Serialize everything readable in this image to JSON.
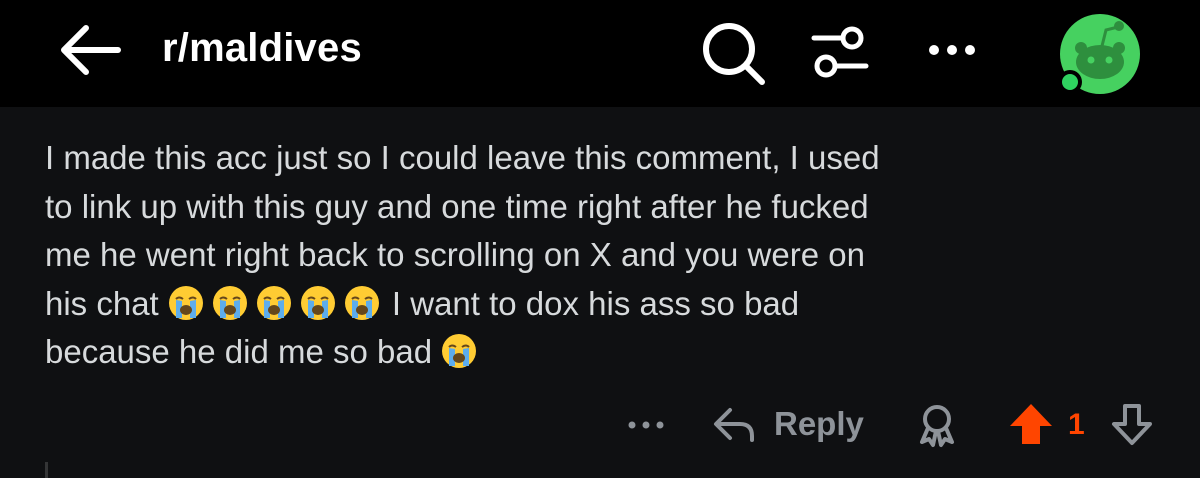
{
  "header": {
    "subreddit": "r/maldives",
    "icons": {
      "back": "arrow-left-icon",
      "search": "search-icon",
      "filter": "filter-sliders-icon",
      "more": "more-horizontal-icon",
      "avatar": "snoo-avatar-icon"
    },
    "avatar_bg": "#46d160",
    "online_dot": "#2fd360"
  },
  "comment": {
    "lines": [
      "I made this acc just so I could leave this comment, I used",
      "to link up with this guy and one time right after he fucked",
      "me he went right back to scrolling on X and you were on",
      "his chat",
      "I want to dox his ass so bad",
      "because he did me so bad"
    ],
    "emoji": "loudly-crying-face-emoji"
  },
  "actions": {
    "reply_label": "Reply",
    "vote_count": "1",
    "upvote_color": "#ff4500",
    "icons": {
      "more": "more-horizontal-icon",
      "reply": "reply-arrow-icon",
      "award": "award-icon",
      "upvote": "upvote-arrow-icon",
      "downvote": "downvote-arrow-icon"
    }
  },
  "colors": {
    "header_bg": "#000000",
    "body_bg": "#0f1012",
    "text": "#d7dadc",
    "muted": "#8e9399"
  }
}
